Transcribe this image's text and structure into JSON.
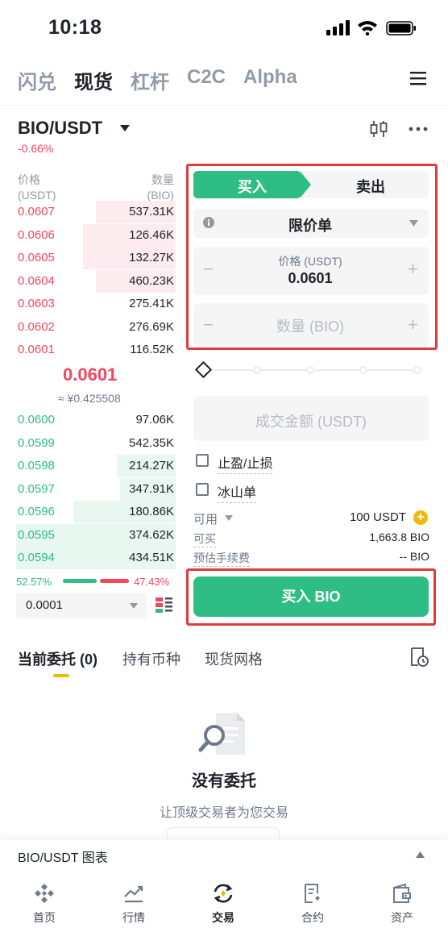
{
  "status_bar": {
    "time": "10:18"
  },
  "top_nav": [
    "闪兑",
    "现货",
    "杠杆",
    "C2C",
    "Alpha"
  ],
  "top_nav_active": "现货",
  "pair": {
    "symbol": "BIO/USDT",
    "change": "-0.66%"
  },
  "order_book": {
    "price_header": "价格",
    "price_unit": "(USDT)",
    "qty_header": "数量",
    "qty_unit": "(BIO)",
    "asks": [
      {
        "price": "0.0607",
        "qty": "537.31K",
        "depth": 0.5
      },
      {
        "price": "0.0606",
        "qty": "126.46K",
        "depth": 0.58
      },
      {
        "price": "0.0605",
        "qty": "132.27K",
        "depth": 0.58
      },
      {
        "price": "0.0604",
        "qty": "460.23K",
        "depth": 0.5
      },
      {
        "price": "0.0603",
        "qty": "275.41K",
        "depth": 0
      },
      {
        "price": "0.0602",
        "qty": "276.69K",
        "depth": 0
      },
      {
        "price": "0.0601",
        "qty": "116.52K",
        "depth": 0
      }
    ],
    "last_price": "0.0601",
    "last_price_fiat": "≈ ¥0.425508",
    "bids": [
      {
        "price": "0.0600",
        "qty": "97.06K",
        "depth": 0
      },
      {
        "price": "0.0599",
        "qty": "542.35K",
        "depth": 0
      },
      {
        "price": "0.0598",
        "qty": "214.27K",
        "depth": 0.37
      },
      {
        "price": "0.0597",
        "qty": "347.91K",
        "depth": 0.35
      },
      {
        "price": "0.0596",
        "qty": "180.86K",
        "depth": 0.64
      },
      {
        "price": "0.0595",
        "qty": "374.62K",
        "depth": 1.0
      },
      {
        "price": "0.0594",
        "qty": "434.51K",
        "depth": 1.0
      }
    ],
    "buy_ratio": "52.57%",
    "sell_ratio": "47.43%",
    "precision": "0.0001"
  },
  "order_form": {
    "buy_tab": "买入",
    "sell_tab": "卖出",
    "order_type": "限价单",
    "price_label": "价格 (USDT)",
    "price_value": "0.0601",
    "minus": "−",
    "plus": "+",
    "qty_placeholder": "数量 (BIO)",
    "total_placeholder": "成交金额 (USDT)",
    "tp_sl": "止盈/止损",
    "iceberg": "冰山单",
    "available_label": "可用",
    "available_value": "100 USDT",
    "can_buy_label": "可买",
    "can_buy_value": "1,663.8 BIO",
    "fee_label": "预估手续费",
    "fee_value": "-- BIO",
    "buy_button": "买入 BIO"
  },
  "bottom_tabs": [
    "当前委托 (0)",
    "持有币种",
    "现货网格"
  ],
  "empty_state": {
    "title": "没有委托",
    "subtitle": "让顶级交易者为您交易"
  },
  "chart_bar": {
    "label": "BIO/USDT 图表"
  },
  "bottom_nav": [
    "首页",
    "行情",
    "交易",
    "合约",
    "资产"
  ],
  "colors": {
    "buy": "#2ebd85",
    "sell": "#f6465d",
    "accent": "#f0b90b",
    "annotation": "#e03a3a"
  }
}
